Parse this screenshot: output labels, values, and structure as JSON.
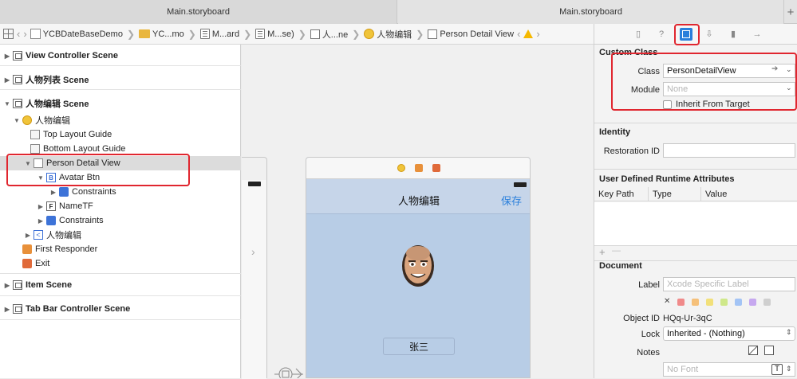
{
  "tabs": [
    "Main.storyboard",
    "Main.storyboard"
  ],
  "tab_add": "+",
  "jumpbar": {
    "items": [
      "YCBDateBaseDemo",
      "YC...mo",
      "M...ard",
      "M...se)",
      "人...ne",
      "人物编辑",
      "Person Detail View"
    ],
    "warning": "!"
  },
  "navigator": {
    "rows": [
      {
        "label": "View Controller Scene"
      },
      {
        "label": "人物列表 Scene"
      },
      {
        "label": "人物编辑 Scene"
      },
      {
        "label": "人物编辑"
      },
      {
        "label": "Top Layout Guide"
      },
      {
        "label": "Bottom Layout Guide"
      },
      {
        "label": "Person Detail View"
      },
      {
        "label": "Avatar Btn"
      },
      {
        "label": "Constraints"
      },
      {
        "label": "NameTF"
      },
      {
        "label": "Constraints"
      },
      {
        "label": "人物编辑"
      },
      {
        "label": "First Responder"
      },
      {
        "label": "Exit"
      },
      {
        "label": "Item Scene"
      },
      {
        "label": "Tab Bar Controller Scene"
      }
    ]
  },
  "canvas": {
    "nav_title": "人物编辑",
    "save": "保存",
    "name_value": "张三",
    "chevron": "›"
  },
  "inspector": {
    "custom_class": {
      "title": "Custom Class",
      "class_label": "Class",
      "class_value": "PersonDetailView",
      "module_label": "Module",
      "module_placeholder": "None",
      "inherit_label": "Inherit From Target"
    },
    "identity": {
      "title": "Identity",
      "restoration_label": "Restoration ID"
    },
    "runtime": {
      "title": "User Defined Runtime Attributes",
      "col_keypath": "Key Path",
      "col_type": "Type",
      "col_value": "Value",
      "add": "+",
      "remove": "—"
    },
    "document": {
      "title": "Document",
      "label_label": "Label",
      "label_placeholder": "Xcode Specific Label",
      "label_clear": "✕",
      "label_colors": [
        "#f08a8a",
        "#f5c07a",
        "#f2e07a",
        "#cfe88a",
        "#a3c4f5",
        "#c6a8ef",
        "#cfcfcf"
      ],
      "objectid_label": "Object ID",
      "objectid_value": "HQq-Ur-3qC",
      "lock_label": "Lock",
      "lock_value": "Inherited - (Nothing)",
      "notes_label": "Notes",
      "font_placeholder": "No Font"
    }
  }
}
